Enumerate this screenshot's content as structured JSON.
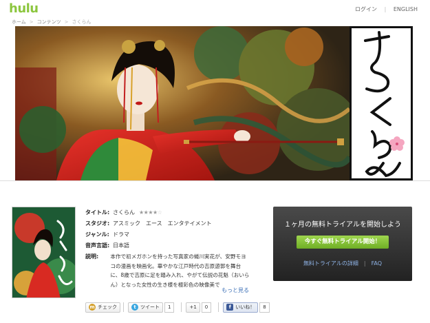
{
  "header": {
    "logo": "hulu",
    "login": "ログイン",
    "language": "ENGLISH"
  },
  "breadcrumb": [
    "ホーム",
    "コンテンツ",
    "さくらん"
  ],
  "hero": {
    "title_calligraphy": "さくらん"
  },
  "details": {
    "title_label": "タイトル:",
    "title_value": "さくらん",
    "rating_stars": 4,
    "rating_max": 5,
    "studio_label": "スタジオ:",
    "studio_value": "アスミック　エース　エンタテイメント",
    "genre_label": "ジャンル:",
    "genre_value": "ドラマ",
    "audio_label": "音声言語:",
    "audio_value": "日本語",
    "desc_label": "説明:",
    "description": "本作で初メガホンを持った写真家の蜷川実花が、安野モヨコの漫画を映画化。華やかな江戸時代の吉原遊郭を舞台に、8歳で吉原に足を踏み入れ、やがて伝説の花魁（おいらん）となった女性の生き様を極彩色の映像美で",
    "more_link": "もっと見る"
  },
  "trial": {
    "heading": "１ヶ月の無料トライアルを開始しよう",
    "button": "今すぐ無料トライアル開始！",
    "details_link": "無料トライアルの詳細",
    "faq_link": "FAQ"
  },
  "social": {
    "check": "チェック",
    "tweet": "ツイート",
    "tweet_count": "1",
    "gplus": "+1",
    "gplus_count": "0",
    "like": "いいね！",
    "like_count": "8"
  },
  "colors": {
    "logo_green": "#8cc63e",
    "trial_button": "#7fbd33",
    "link_blue": "#3b6fb6"
  }
}
